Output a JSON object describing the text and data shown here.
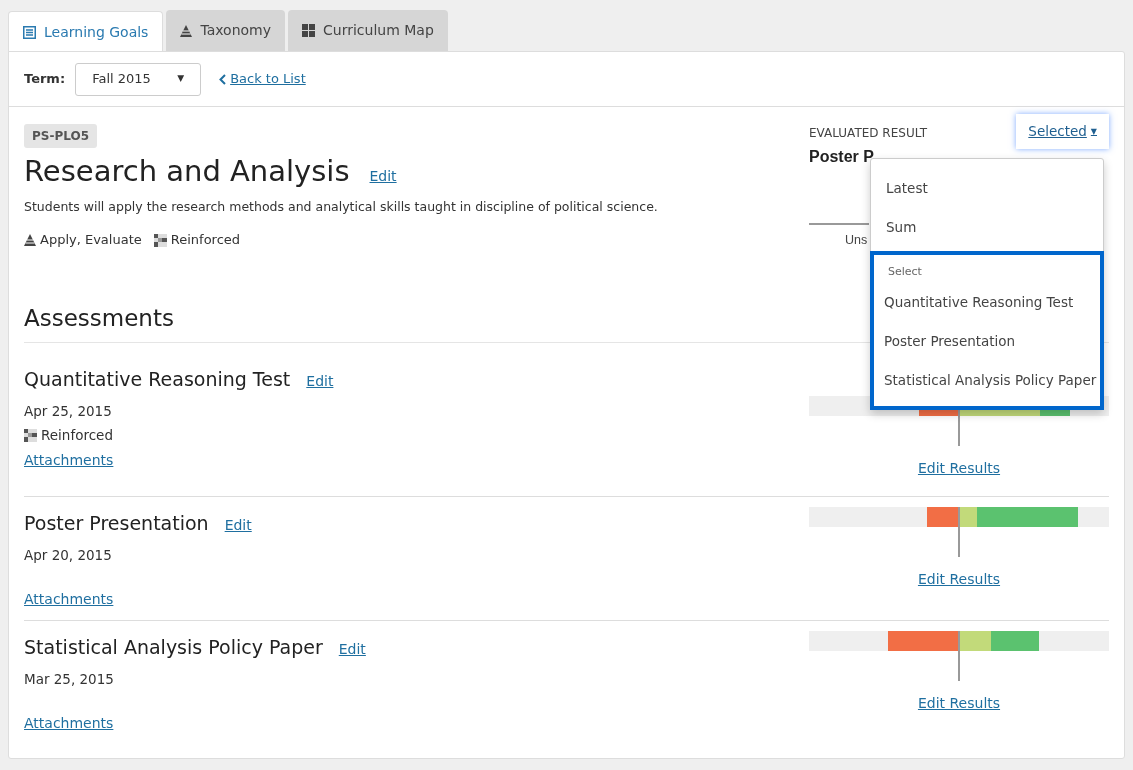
{
  "tabs": [
    {
      "label": "Learning Goals",
      "selected": true
    },
    {
      "label": "Taxonomy",
      "selected": false
    },
    {
      "label": "Curriculum Map",
      "selected": false
    }
  ],
  "term": {
    "label": "Term:",
    "value": "Fall 2015",
    "caret": "▼"
  },
  "back_link": "Back to List",
  "goal": {
    "code": "PS-PLO5",
    "title": "Research and Analysis",
    "edit": "Edit",
    "description": "Students will apply the research methods and analytical skills taught in discipline of political science.",
    "taxonomy": "Apply, Evaluate",
    "level": "Reinforced"
  },
  "evaluated": {
    "label": "EVALUATED RESULT",
    "title": "Poster P",
    "fragment": "Uns",
    "button": "Selected",
    "caret": "▼"
  },
  "dropdown": {
    "items": [
      "Latest",
      "Sum"
    ],
    "group_label": "Select",
    "group_items": [
      "Quantitative Reasoning Test",
      "Poster Presentation",
      "Statistical Analysis Policy Paper"
    ]
  },
  "assessments_heading": "Assessments",
  "assessments": [
    {
      "title": "Quantitative Reasoning Test",
      "edit": "Edit",
      "date": "Apr 25, 2015",
      "level": "Reinforced",
      "attachments": "Attachments",
      "results_link": "Edit Results"
    },
    {
      "title": "Poster Presentation",
      "edit": "Edit",
      "date": "Apr 20, 2015",
      "attachments": "Attachments",
      "results_link": "Edit Results"
    },
    {
      "title": "Statistical Analysis Policy Paper",
      "edit": "Edit",
      "date": "Mar 25, 2015",
      "attachments": "Attachments",
      "results_link": "Edit Results"
    }
  ]
}
